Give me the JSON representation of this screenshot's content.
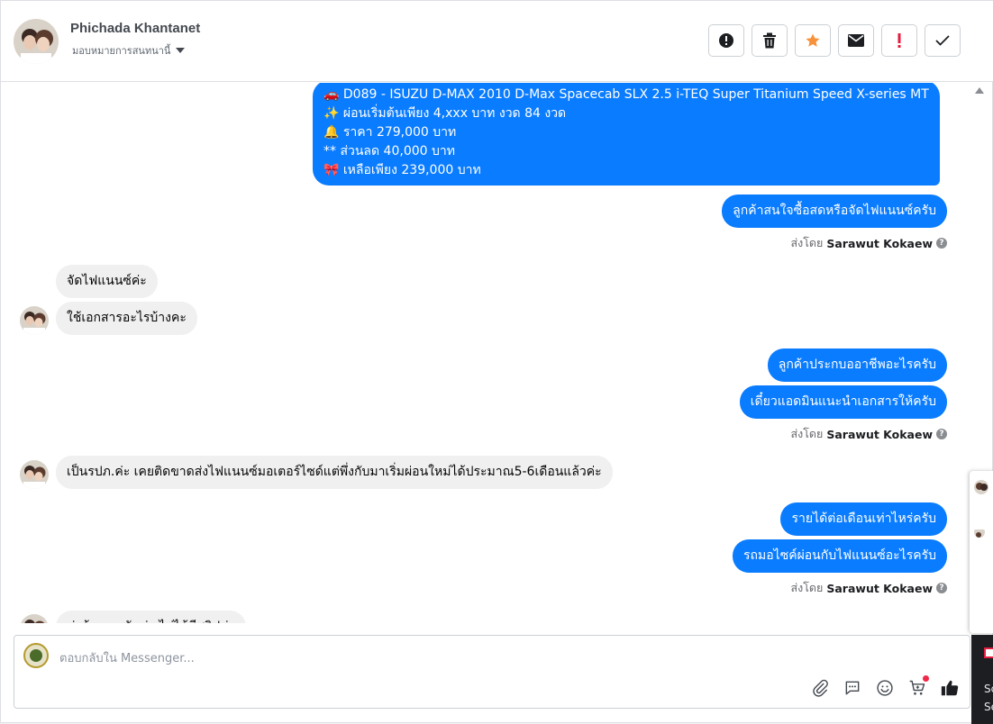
{
  "header": {
    "name": "Phichada Khantanet",
    "assigned": "มอบหมายการสนทนานี้"
  },
  "actions": [
    {
      "icon": "alert-circle-icon"
    },
    {
      "icon": "trash-icon"
    },
    {
      "icon": "star-icon"
    },
    {
      "icon": "envelope-icon"
    },
    {
      "icon": "exclamation-icon"
    },
    {
      "icon": "checkmark-icon"
    }
  ],
  "messages": {
    "car_listing": {
      "line1": "🚗 D089 - ISUZU D-MAX 2010 D-Max Spacecab SLX 2.5 i-TEQ Super Titanium Speed X-series MT",
      "line2": "✨ ผ่อนเริ่มต้นเพียง 4,xxx บาท งวด 84 งวด",
      "line3": "🔔  ราคา 279,000 บาท",
      "line4": "** ส่วนลด 40,000 บาท",
      "line5": "🎀 เหลือเพียง 239,000 บาท"
    },
    "out_1": "ลูกค้าสนใจซื้อสดหรือจัดไฟแนนซ์ครับ",
    "in_1": "จัดไฟแนนซ์ค่ะ",
    "in_2": "ใช้เอกสารอะไรบ้างคะ",
    "out_2": "ลูกค้าประกบออาชีพอะไรครับ",
    "out_3": "เดี๋ยวแอดมินแนะนำเอกสารให้ครับ",
    "in_3": "เป็นรปภ.ค่ะ เคยติดขาดส่งไฟแนนซ์มอเตอร์ไซด์แต่พึ่งกับมาเริ่มผ่อนใหม่ได้ประมาณ5-6เดือนแล้วค่ะ",
    "out_4": "รายได้ต่อเดือนเท่าไหร่ครับ",
    "out_5": "รถมอไซค์ผ่อนกับไฟแนนซ์อะไรครับ",
    "in_4_partial": "ค่าจ้างรายวันค่ะ ไม่ได้มีสลิปค่ะ"
  },
  "sent_by": {
    "prefix": "ส่งโดย",
    "agent": "Sarawut Kokaew",
    "help": "?"
  },
  "composer": {
    "placeholder": "ตอบกลับใน Messenger..."
  },
  "tools": [
    {
      "icon": "paperclip-icon"
    },
    {
      "icon": "saved-reply-icon"
    },
    {
      "icon": "emoji-icon"
    },
    {
      "icon": "cart-icon"
    },
    {
      "icon": "thumbs-up-icon"
    }
  ],
  "side": {
    "text1": "Sc",
    "text2": "Se"
  },
  "colors": {
    "outgoing": "#0a7cff",
    "incoming": "#f0f0f0",
    "star": "#f7923a",
    "exclamation": "#e41e3f"
  }
}
